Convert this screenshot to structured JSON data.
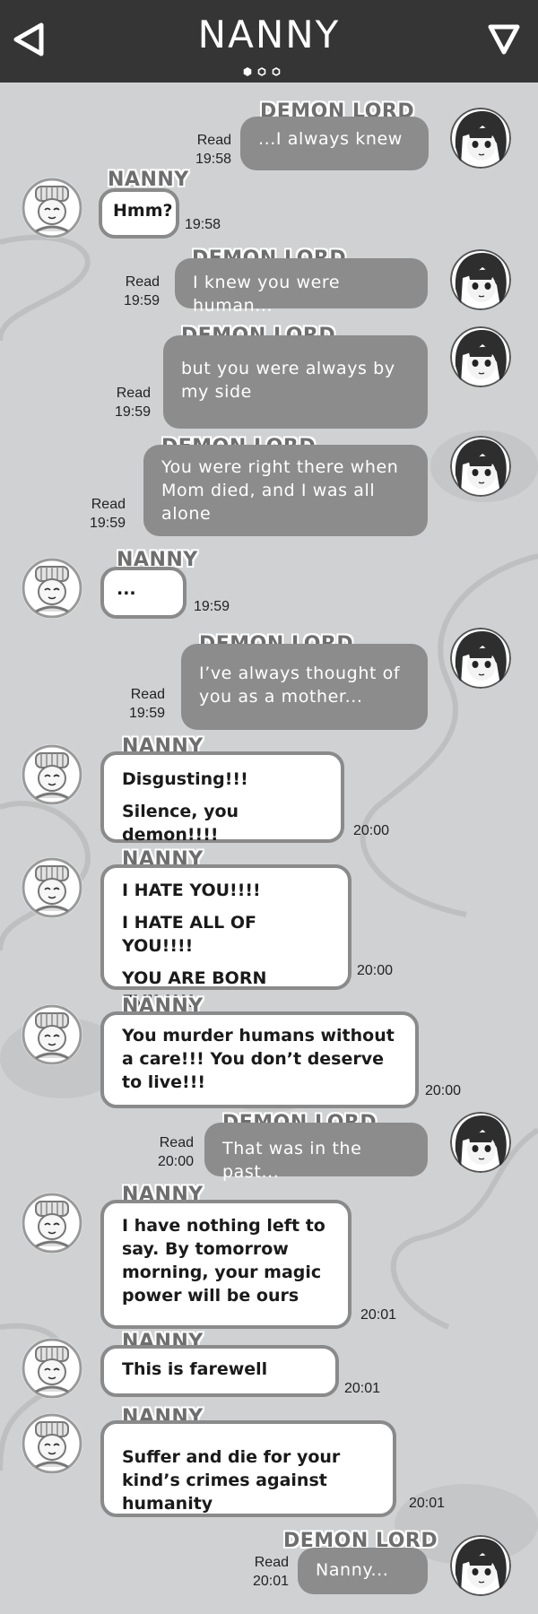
{
  "header": {
    "title": "NANNY",
    "back_icon": "back-triangle-icon",
    "menu_icon": "down-triangle-icon"
  },
  "colors": {
    "header_bg": "#353535",
    "chat_bg": "#cfd1d3",
    "demon_bubble": "#8c8c8c",
    "nanny_bubble": "#ffffff",
    "nanny_border": "#8a8a8a"
  },
  "messages": [
    {
      "sender": "DEMON LORD",
      "lines": [
        "...I always knew"
      ],
      "read": "Read",
      "time": "19:58"
    },
    {
      "sender": "NANNY",
      "lines": [
        "Hmm?"
      ],
      "time": "19:58"
    },
    {
      "sender": "DEMON LORD",
      "lines": [
        "I knew you were human..."
      ],
      "read": "Read",
      "time": "19:59"
    },
    {
      "sender": "DEMON LORD",
      "lines": [
        "but you were always by my side"
      ],
      "read": "Read",
      "time": "19:59"
    },
    {
      "sender": "DEMON LORD",
      "lines": [
        "You were right there when Mom died, and I was all alone"
      ],
      "read": "Read",
      "time": "19:59"
    },
    {
      "sender": "NANNY",
      "lines": [
        "..."
      ],
      "time": "19:59"
    },
    {
      "sender": "DEMON LORD",
      "lines": [
        "I’ve always thought of you as a mother..."
      ],
      "read": "Read",
      "time": "19:59"
    },
    {
      "sender": "NANNY",
      "lines": [
        "Disgusting!!!",
        "Silence, you demon!!!!"
      ],
      "time": "20:00"
    },
    {
      "sender": "NANNY",
      "lines": [
        "I HATE YOU!!!!",
        "I HATE ALL OF YOU!!!!",
        "YOU ARE BORN EVIL!!!!"
      ],
      "time": "20:00"
    },
    {
      "sender": "NANNY",
      "lines": [
        "You murder humans without a care!!! You don’t deserve to live!!!"
      ],
      "time": "20:00"
    },
    {
      "sender": "DEMON LORD",
      "lines": [
        "That was in the past..."
      ],
      "read": "Read",
      "time": "20:00"
    },
    {
      "sender": "NANNY",
      "lines": [
        "I have nothing left to say. By tomorrow morning, your magic power will be ours"
      ],
      "time": "20:01"
    },
    {
      "sender": "NANNY",
      "lines": [
        "This is farewell"
      ],
      "time": "20:01"
    },
    {
      "sender": "NANNY",
      "lines": [
        "Suffer and die for your kind’s crimes against humanity"
      ],
      "time": "20:01"
    },
    {
      "sender": "DEMON LORD",
      "lines": [
        "Nanny..."
      ],
      "read": "Read",
      "time": "20:01"
    }
  ]
}
